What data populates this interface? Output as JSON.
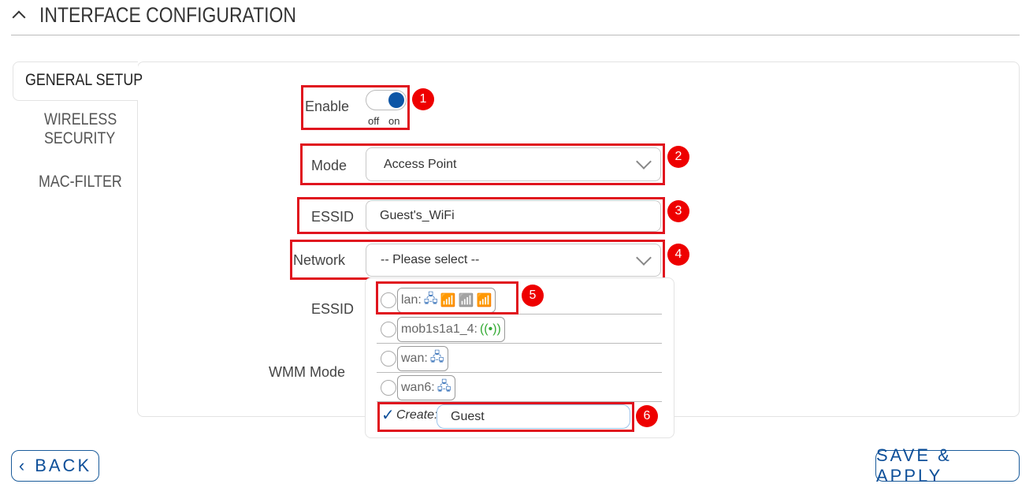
{
  "header": {
    "title": "INTERFACE CONFIGURATION",
    "collapse_icon": "chevron-up-icon"
  },
  "tabs": [
    {
      "label": "GENERAL SETUP",
      "active": true
    },
    {
      "label": "WIRELESS SECURITY",
      "line1": "WIRELESS",
      "line2": "SECURITY"
    },
    {
      "label": "MAC-FILTER"
    }
  ],
  "form": {
    "enable": {
      "label": "Enable",
      "off": "off",
      "on": "on",
      "value": true
    },
    "mode": {
      "label": "Mode",
      "value": "Access Point"
    },
    "essid": {
      "label": "ESSID",
      "value": "Guest's_WiFi"
    },
    "network": {
      "label": "Network",
      "value": "-- Please select --"
    },
    "essid2": {
      "label": "ESSID"
    },
    "wmm": {
      "label": "WMM Mode"
    }
  },
  "network_options": [
    {
      "label": "lan:",
      "icons": [
        "ethernet-icon",
        "wifi-icon",
        "wifi-icon",
        "wifi-icon"
      ]
    },
    {
      "label": "mob1s1a1_4:",
      "icons": [
        "mobile-antenna-icon"
      ]
    },
    {
      "label": "wan:",
      "icons": [
        "ethernet-icon"
      ]
    },
    {
      "label": "wan6:",
      "icons": [
        "ethernet-icon"
      ]
    }
  ],
  "create": {
    "label": "Create:",
    "value": "Guest",
    "checked": true
  },
  "badges": [
    "1",
    "2",
    "3",
    "4",
    "5",
    "6"
  ],
  "buttons": {
    "back": "BACK",
    "save": "SAVE & APPLY"
  },
  "colors": {
    "accent": "#0d4f99",
    "annotation": "#e0141e"
  }
}
